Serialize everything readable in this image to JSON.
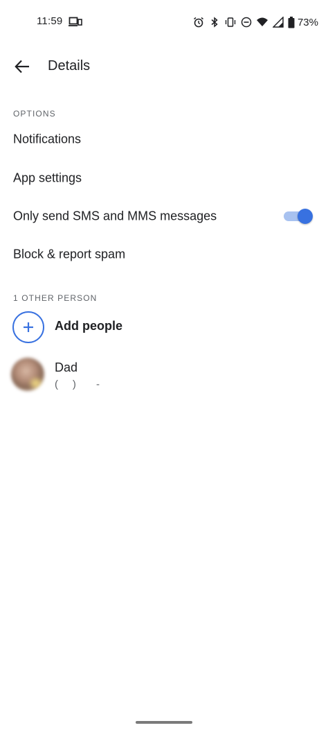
{
  "status_bar": {
    "time": "11:59",
    "battery_percent": "73%",
    "icons": [
      "cast-icon",
      "alarm-icon",
      "bluetooth-icon",
      "vibrate-icon",
      "dnd-icon",
      "wifi-icon",
      "signal-icon",
      "battery-icon"
    ]
  },
  "app_bar": {
    "title": "Details"
  },
  "options_section": {
    "header": "OPTIONS",
    "items": [
      {
        "label": "Notifications"
      },
      {
        "label": "App settings"
      },
      {
        "label": "Only send SMS and MMS messages",
        "toggle_on": true
      },
      {
        "label": "Block & report spam"
      }
    ]
  },
  "people_section": {
    "header": "1 OTHER PERSON",
    "add_label": "Add people",
    "contacts": [
      {
        "name": "Dad",
        "number": "(     )       -"
      }
    ]
  },
  "colors": {
    "accent": "#3871e0",
    "toggle_track": "#a8c2f0",
    "text_primary": "#202124",
    "text_secondary": "#5f6368"
  }
}
